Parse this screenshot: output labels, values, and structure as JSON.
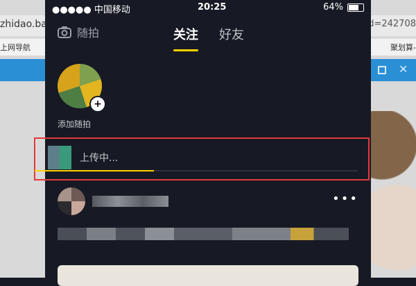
{
  "background": {
    "address_left": "zhidao.ba",
    "address_right": "d=242708",
    "bookmark_left": "上网导航",
    "bookmark_right": "聚划算-"
  },
  "status": {
    "carrier": "●●●●● 中国移动",
    "time": "20:25",
    "battery": "64%"
  },
  "nav": {
    "camera_label": "随拍",
    "tabs": [
      "关注",
      "好友"
    ]
  },
  "add": {
    "label": "添加随拍",
    "plus": "+"
  },
  "upload": {
    "text": "上传中...",
    "progress": 0.37
  },
  "feed": {
    "more": "•••"
  }
}
